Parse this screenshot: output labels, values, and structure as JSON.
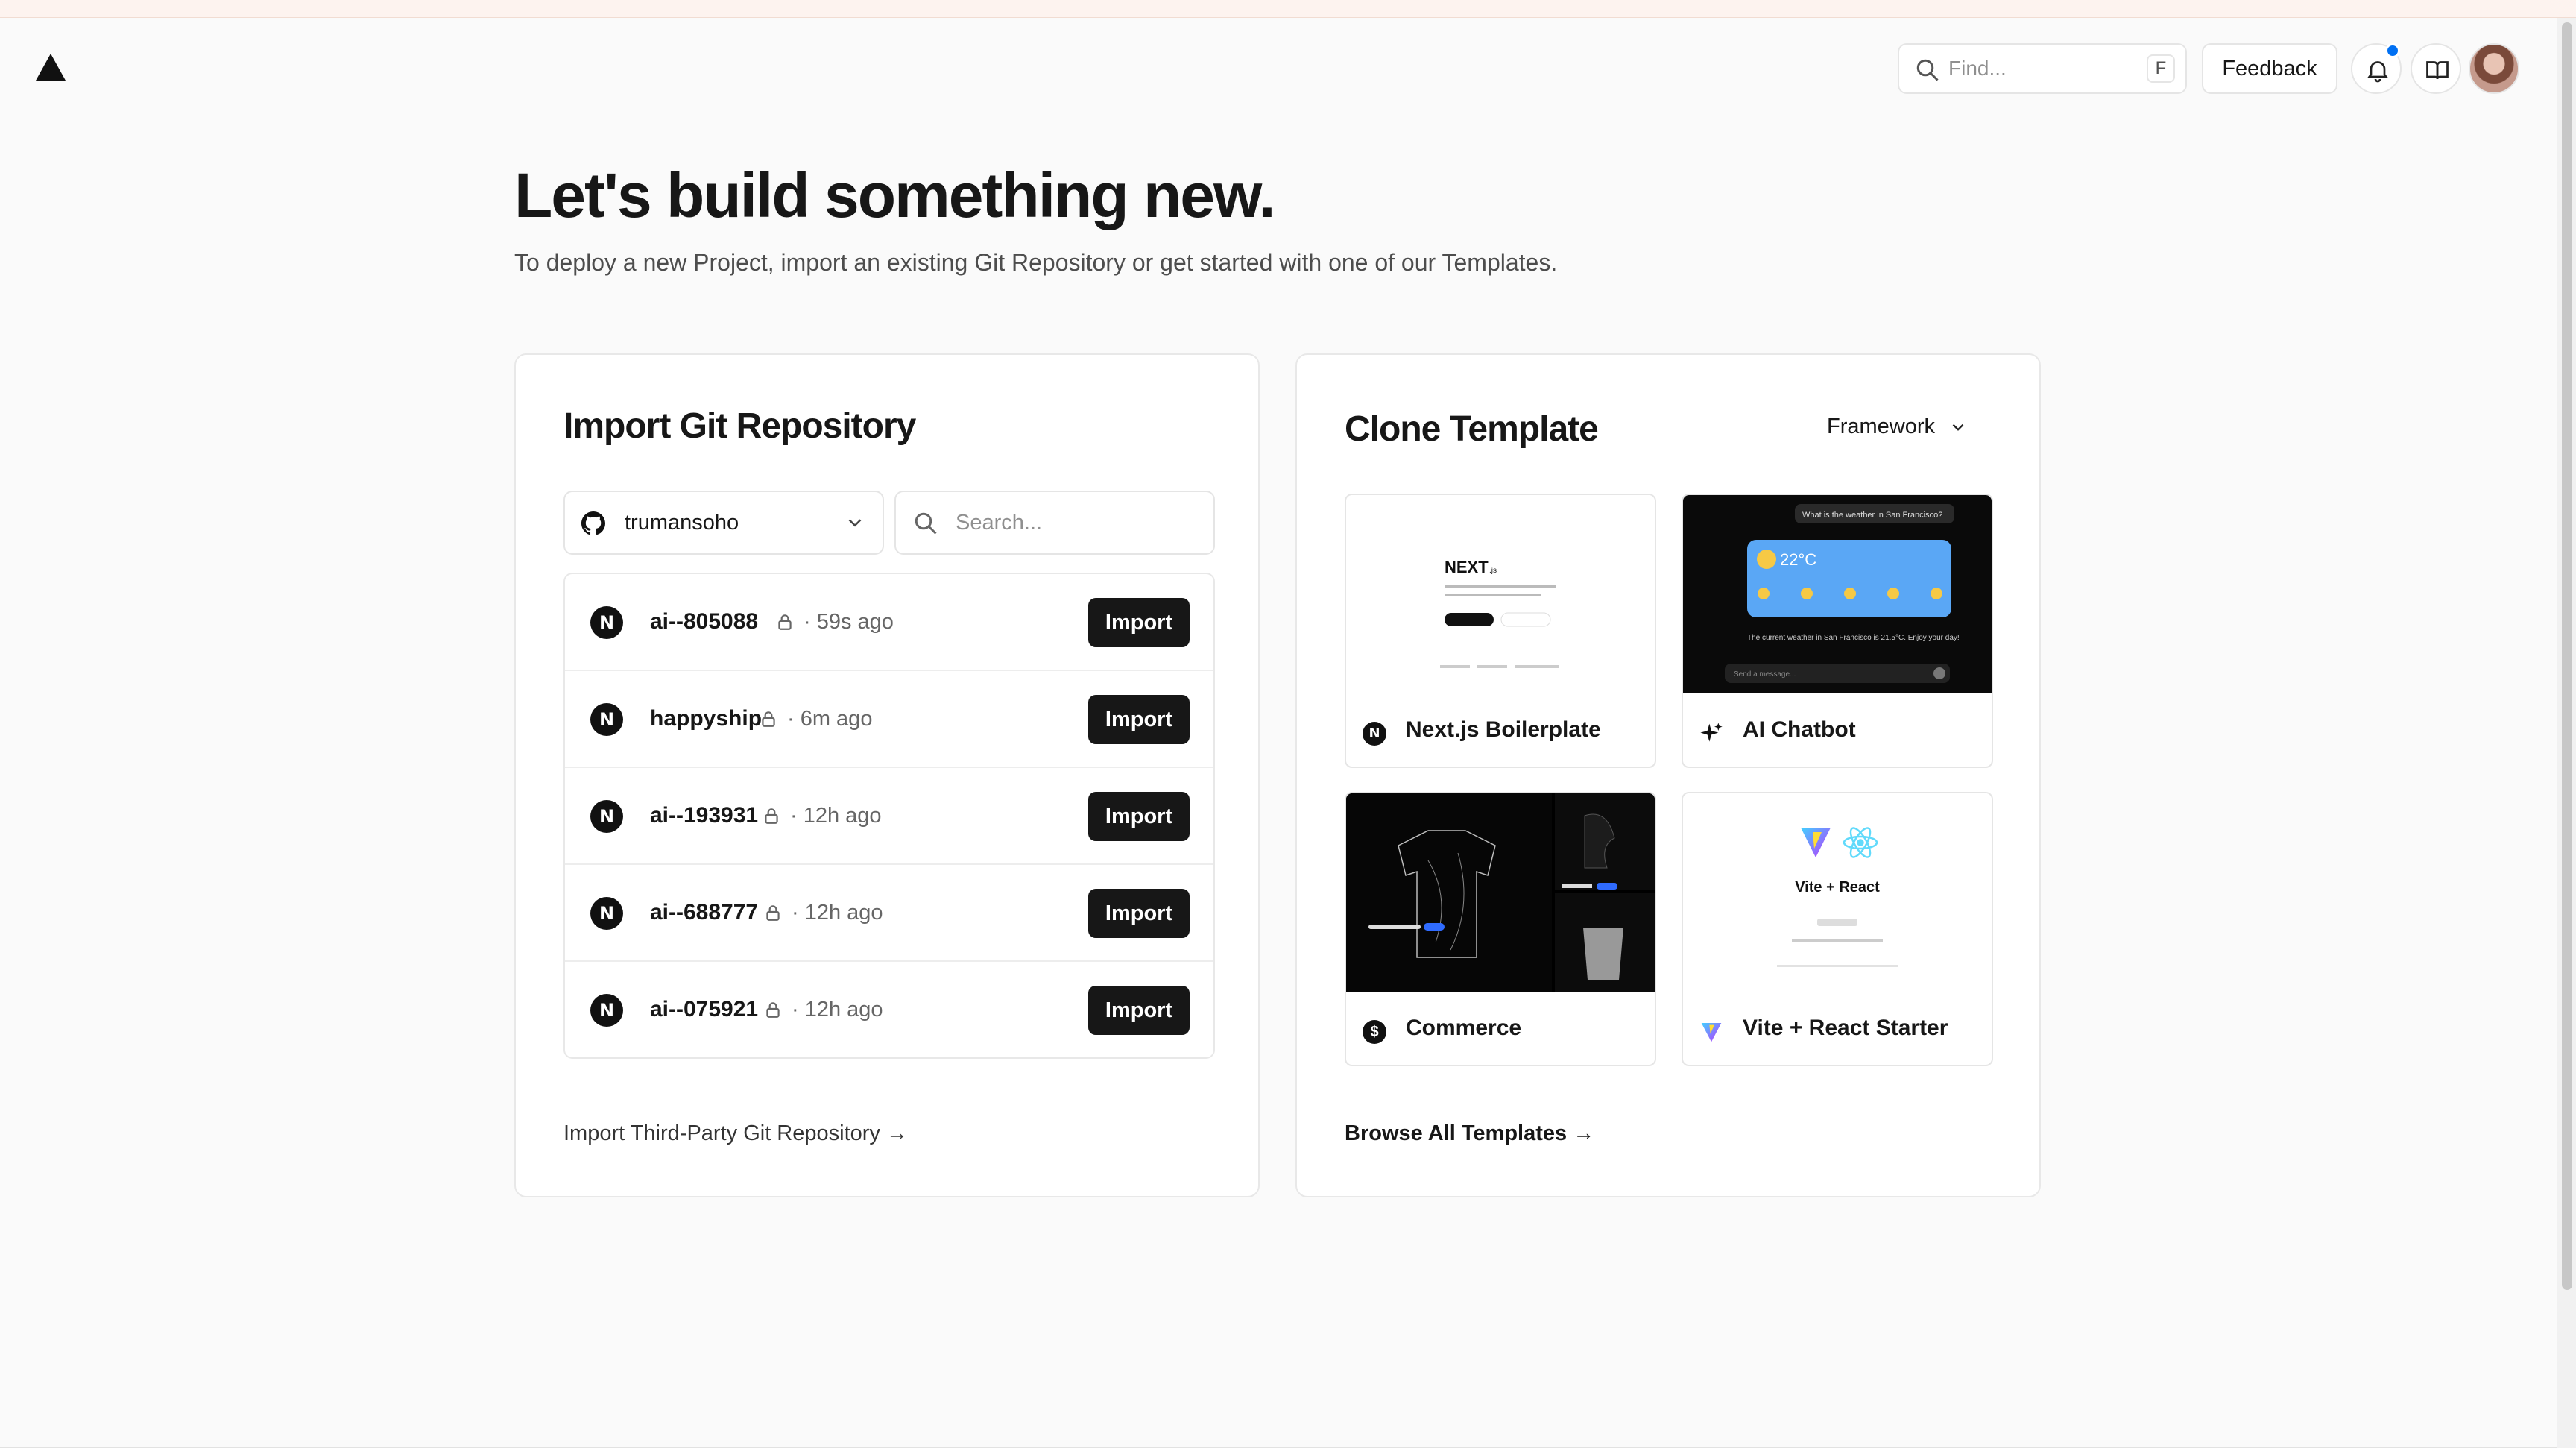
{
  "header": {
    "search_placeholder": "Find...",
    "search_shortcut": "F",
    "feedback_label": "Feedback"
  },
  "hero": {
    "title": "Let's build something new.",
    "subtitle": "To deploy a new Project, import an existing Git Repository or get started with one of our Templates."
  },
  "import_card": {
    "title": "Import Git Repository",
    "account": "trumansoho",
    "search_placeholder": "Search...",
    "import_label": "Import",
    "repos": [
      {
        "name": "ai--805088",
        "time": "· 59s ago"
      },
      {
        "name": "happyship",
        "time": "· 6m ago"
      },
      {
        "name": "ai--193931",
        "time": "· 12h ago"
      },
      {
        "name": "ai--688777",
        "time": "· 12h ago"
      },
      {
        "name": "ai--075921",
        "time": "· 12h ago"
      }
    ],
    "third_party_link": "Import Third-Party Git Repository →"
  },
  "template_card": {
    "title": "Clone Template",
    "framework_label": "Framework",
    "templates": [
      {
        "name": "Next.js Boilerplate"
      },
      {
        "name": "AI Chatbot"
      },
      {
        "name": "Commerce"
      },
      {
        "name": "Vite + React Starter"
      }
    ],
    "previews": {
      "next_logo": "NEXT",
      "next_logo_sub": ".js",
      "chat_question": "What is the weather in San Francisco?",
      "chat_temp": "22°C",
      "chat_answer": "The current weather in San Francisco is 21.5°C. Enjoy your day!",
      "chat_input": "Send a message...",
      "vite_title": "Vite + React"
    },
    "browse_link": "Browse All Templates →"
  },
  "colors": {
    "accent_blue": "#0070f3",
    "button_dark": "#171717",
    "background": "#fafafa"
  }
}
